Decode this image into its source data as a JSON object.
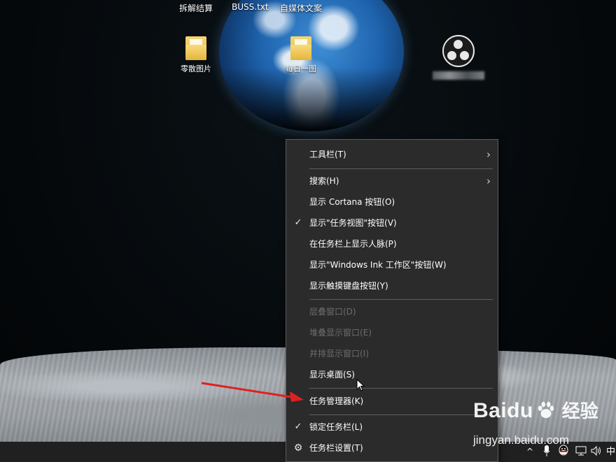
{
  "desktop": {
    "top_labels": [
      "拆解结算",
      "BUSS.txt",
      "自媒体文案"
    ],
    "icons": [
      {
        "label": "零散图片",
        "icon": "folder-icon"
      },
      {
        "label": "每日一图",
        "icon": "folder-icon"
      },
      {
        "label": "",
        "icon": "obs-studio-icon"
      }
    ]
  },
  "context_menu": {
    "items": [
      {
        "label": "工具栏(T)",
        "submenu": true
      },
      {
        "label": "搜索(H)",
        "submenu": true
      },
      {
        "label": "显示 Cortana 按钮(O)"
      },
      {
        "label": "显示\"任务视图\"按钮(V)",
        "checked": true
      },
      {
        "label": "在任务栏上显示人脉(P)"
      },
      {
        "label": "显示\"Windows Ink 工作区\"按钮(W)"
      },
      {
        "label": "显示触摸键盘按钮(Y)"
      },
      {
        "label": "层叠窗口(D)",
        "disabled": true
      },
      {
        "label": "堆叠显示窗口(E)",
        "disabled": true
      },
      {
        "label": "并排显示窗口(I)",
        "disabled": true
      },
      {
        "label": "显示桌面(S)"
      },
      {
        "label": "任务管理器(K)"
      },
      {
        "label": "锁定任务栏(L)",
        "checked": true
      },
      {
        "label": "任务栏设置(T)",
        "icon": "gear-icon"
      }
    ]
  },
  "taskbar": {
    "tray": {
      "chevron": "^",
      "ime": "中",
      "icons": [
        "microphone-icon",
        "qq-icon",
        "network-icon",
        "volume-icon"
      ]
    }
  },
  "watermark": {
    "brand": "Baidu",
    "brand_cn": "经验",
    "url": "jingyan.baidu.com"
  },
  "colors": {
    "menu_bg": "#2b2b2b",
    "menu_text": "#ffffff",
    "menu_disabled": "#6d6d6d",
    "arrow": "#e02020",
    "taskbar": "#202020"
  }
}
